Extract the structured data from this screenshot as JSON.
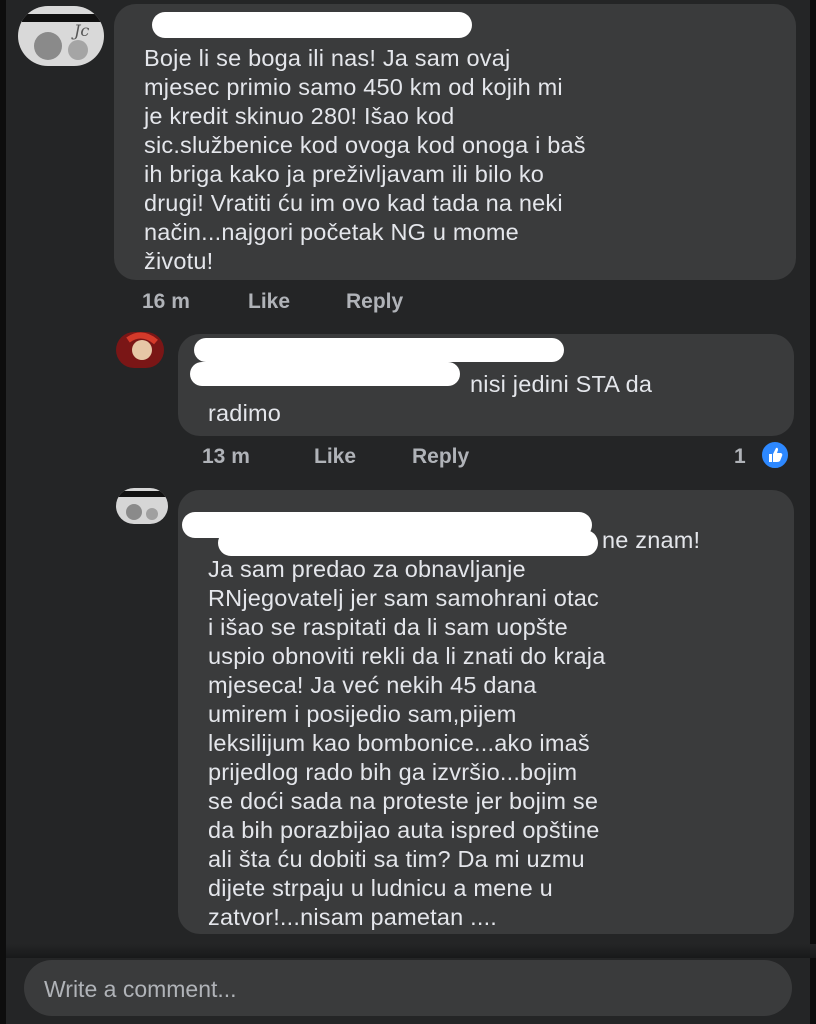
{
  "comments": [
    {
      "text": "Boje li se boga ili nas! Ja sam ovaj\nmjesec primio samo 450 km od kojih mi\nje kredit skinuo 280! Išao kod\nsic.službenice kod ovoga kod onoga i baš\nih briga kako ja preživljavam ili bilo ko\ndrugi! Vratiti ću im ovo kad tada na neki\nnačin...najgori početak NG u mome\nživotu!",
      "time": "16 m",
      "like_label": "Like",
      "reply_label": "Reply"
    },
    {
      "text_after_mention": "nisi jedini STA da\nradimo",
      "time": "13 m",
      "like_label": "Like",
      "reply_label": "Reply",
      "reaction_count": "1"
    },
    {
      "text_after_mention": "ne znam!",
      "text": "Ja sam predao za obnavljanje\nRNjegovatelj jer sam samohrani otac\ni išao se raspitati da li sam uopšte\nuspio obnoviti rekli da li znati do kraja\nmjeseca! Ja već nekih 45 dana\numirem i posijedio sam,pijem\nleksilijum kao bombonice...ako imaš\nprijedlog rado bih ga izvršio...bojim\nse doći sada na proteste jer bojim se\nda bih porazbijao auta ispred opštine\nali šta ću dobiti sa tim? Da mi uzmu\ndijete strpaju u ludnicu a mene u\nzatvor!...nisam pametan ...."
    }
  ],
  "composer": {
    "placeholder": "Write a comment..."
  },
  "colors": {
    "background": "#242526",
    "bubble": "#3a3b3c",
    "text": "#e4e6eb",
    "meta": "#b0b3b8",
    "mention": "#4599ff",
    "like_reaction": "#2d88ff"
  },
  "icons": {
    "reaction": "thumbs-up-icon"
  }
}
